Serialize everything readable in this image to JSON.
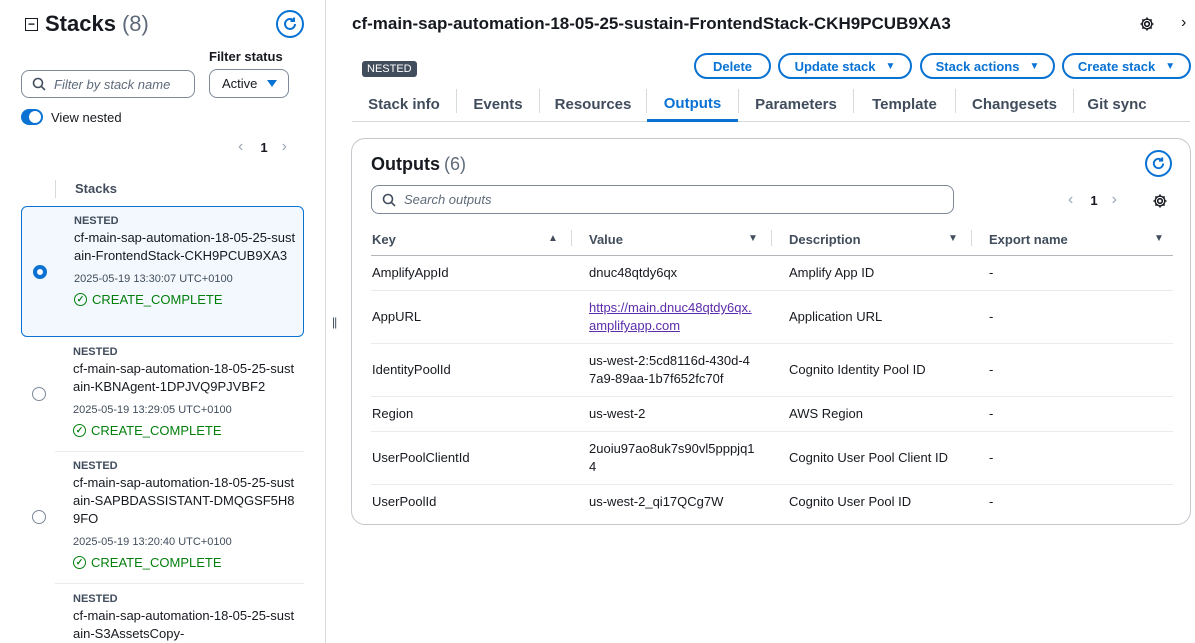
{
  "left": {
    "title": "Stacks",
    "count": "(8)",
    "filter_placeholder": "Filter by stack name",
    "filter_status_label": "Filter status",
    "filter_status_value": "Active",
    "view_nested_label": "View nested",
    "view_nested_on": true,
    "page": "1",
    "column_header": "Stacks",
    "stacks": [
      {
        "tag": "NESTED",
        "name": "cf-main-sap-automation-18-05-25-sustain-FrontendStack-CKH9PCUB9XA3",
        "time": "2025-05-19 13:30:07 UTC+0100",
        "status": "CREATE_COMPLETE",
        "selected": true
      },
      {
        "tag": "NESTED",
        "name": "cf-main-sap-automation-18-05-25-sustain-KBNAgent-1DPJVQ9PJVBF2",
        "time": "2025-05-19 13:29:05 UTC+0100",
        "status": "CREATE_COMPLETE",
        "selected": false
      },
      {
        "tag": "NESTED",
        "name": "cf-main-sap-automation-18-05-25-sustain-SAPBDASSISTANT-DMQGSF5H89FO",
        "time": "2025-05-19 13:20:40 UTC+0100",
        "status": "CREATE_COMPLETE",
        "selected": false
      },
      {
        "tag": "NESTED",
        "name": "cf-main-sap-automation-18-05-25-sustain-S3AssetsCopy-",
        "time": "",
        "status": "",
        "selected": false
      }
    ]
  },
  "main": {
    "title": "cf-main-sap-automation-18-05-25-sustain-FrontendStack-CKH9PCUB9XA3",
    "badge": "NESTED",
    "buttons": {
      "delete": "Delete",
      "update": "Update stack",
      "actions": "Stack actions",
      "create": "Create stack"
    },
    "tabs": [
      "Stack info",
      "Events",
      "Resources",
      "Outputs",
      "Parameters",
      "Template",
      "Changesets",
      "Git sync"
    ],
    "active_tab": "Outputs"
  },
  "outputs": {
    "title": "Outputs",
    "count": "(6)",
    "search_placeholder": "Search outputs",
    "page": "1",
    "columns": [
      "Key",
      "Value",
      "Description",
      "Export name"
    ],
    "rows": [
      {
        "key": "AmplifyAppId",
        "value": "dnuc48qtdy6qx",
        "description": "Amplify App ID",
        "export": "-"
      },
      {
        "key": "AppURL",
        "value": "https://main.dnuc48qtdy6qx.amplifyapp.com",
        "description": "Application URL",
        "export": "-"
      },
      {
        "key": "IdentityPoolId",
        "value": "us-west-2:5cd8116d-430d-47a9-89aa-1b7f652fc70f",
        "description": "Cognito Identity Pool ID",
        "export": "-"
      },
      {
        "key": "Region",
        "value": "us-west-2",
        "description": "AWS Region",
        "export": "-"
      },
      {
        "key": "UserPoolClientId",
        "value": "2uoiu97ao8uk7s90vl5pppjq14",
        "description": "Cognito User Pool Client ID",
        "export": "-"
      },
      {
        "key": "UserPoolId",
        "value": "us-west-2_qi17QCg7W",
        "description": "Cognito User Pool ID",
        "export": "-"
      }
    ]
  },
  "colors": {
    "accent": "#0972d3",
    "success": "#037f0c",
    "link_visited": "#5c2cab"
  }
}
